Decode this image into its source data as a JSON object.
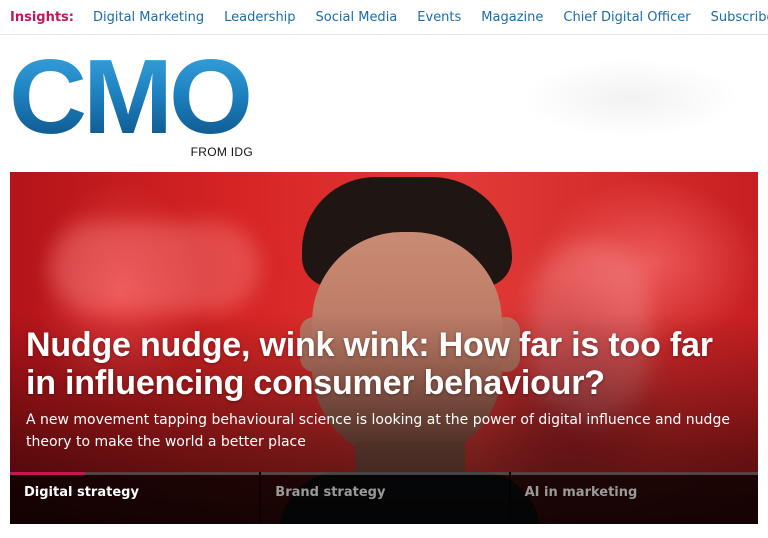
{
  "topnav": {
    "label": "Insights:",
    "links": [
      "Digital Marketing",
      "Leadership",
      "Social Media",
      "Events",
      "Magazine",
      "Chief Digital Officer",
      "Subscribe"
    ]
  },
  "logo": {
    "mark": "CMO",
    "tagline": "FROM IDG"
  },
  "hero": {
    "title": "Nudge nudge, wink wink: How far is too far in influencing consumer behaviour?",
    "subtitle": "A new movement tapping behavioural science is looking at the power of digital influence and nudge theory to make the world a better place"
  },
  "tabs": [
    {
      "label": "Digital strategy",
      "active": true,
      "progress": 0.3
    },
    {
      "label": "Brand strategy",
      "active": false,
      "progress": 0
    },
    {
      "label": "AI in marketing",
      "active": false,
      "progress": 0
    }
  ],
  "colors": {
    "accent": "#c2185b",
    "link": "#1b6ca8"
  }
}
